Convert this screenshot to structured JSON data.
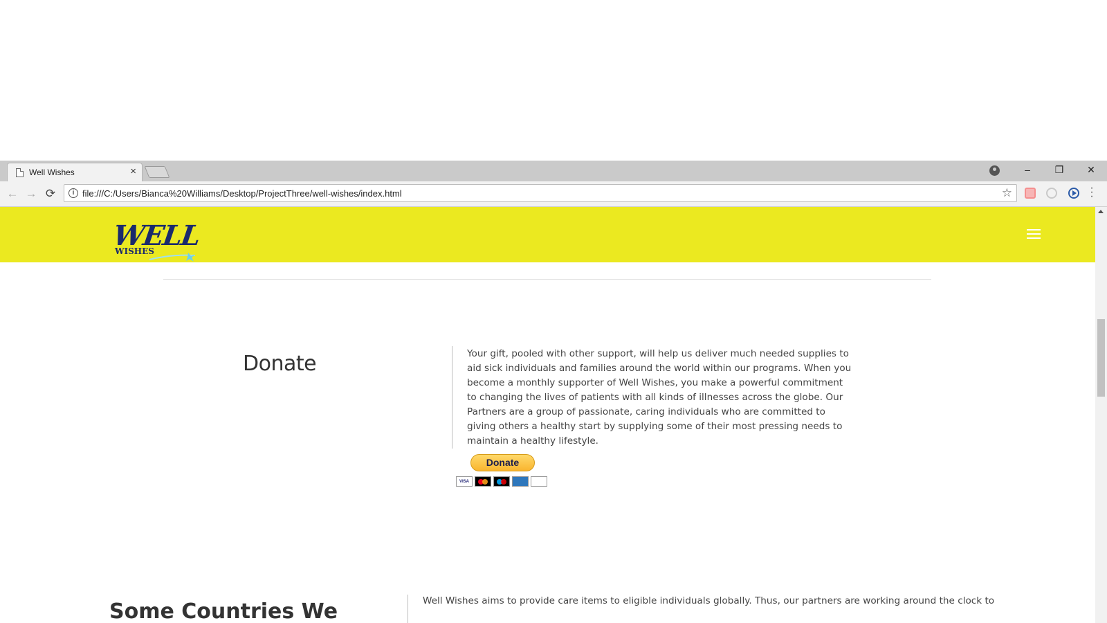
{
  "browser": {
    "tab_title": "Well Wishes",
    "tab_close": "×",
    "url": "file:///C:/Users/Bianca%20Williams/Desktop/ProjectThree/well-wishes/index.html",
    "window_controls": {
      "minimize": "–",
      "restore": "❐",
      "close": "✕"
    },
    "nav": {
      "back": "←",
      "forward": "→",
      "reload": "⟳"
    },
    "info_glyph": "i",
    "star_glyph": "☆"
  },
  "site": {
    "logo": {
      "line1": "WELL",
      "line2": "WISHES"
    },
    "header_color": "#ebe920",
    "donate": {
      "heading": "Donate",
      "body": "Your gift, pooled with other support, will help us deliver much needed supplies to aid sick individuals and families around the world within our programs. When you become a monthly supporter of Well Wishes, you make a powerful commitment to changing the lives of patients with all kinds of illnesses across the globe. Our Partners are a group of passionate, caring individuals who are committed to giving others a healthy start by supplying some of their most pressing needs to maintain a healthy lifestyle.",
      "button_label": "Donate",
      "cards": {
        "visa": "VISA",
        "amex": "AMERICAN EXPRESS",
        "discover": "DISCOVER"
      }
    },
    "countries": {
      "heading": "Some Countries We",
      "body": "Well Wishes aims to provide care items to eligible individuals globally. Thus, our partners are working around the clock to"
    }
  }
}
